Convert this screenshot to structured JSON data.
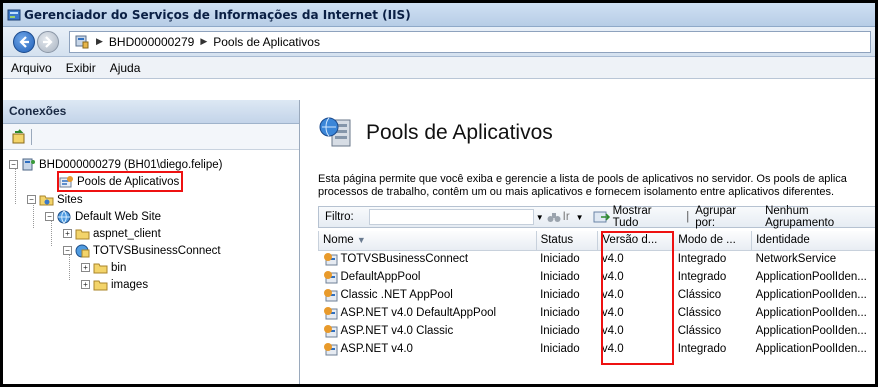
{
  "window": {
    "title": "Gerenciador do Serviços de Informações da Internet (IIS)"
  },
  "address": {
    "segments": [
      "BHD000000279",
      "Pools de Aplicativos"
    ]
  },
  "menu": {
    "items": [
      "Arquivo",
      "Exibir",
      "Ajuda"
    ]
  },
  "connections": {
    "header": "Conexões",
    "tree": {
      "server": "BHD000000279 (BH01\\diego.felipe)",
      "app_pools": "Pools de Aplicativos",
      "sites": "Sites",
      "default_site": "Default Web Site",
      "aspnet_client": "aspnet_client",
      "totvs": "TOTVSBusinessConnect",
      "bin": "bin",
      "images": "images"
    }
  },
  "content": {
    "title": "Pools de Aplicativos",
    "description_line1": "Esta página permite que você exiba e gerencie a lista de pools de aplicativos no servidor. Os pools de aplica",
    "description_line2": "processos de trabalho, contêm um ou mais aplicativos e fornecem isolamento entre aplicativos diferentes.",
    "filter": {
      "label": "Filtro:",
      "go_label": "Ir",
      "show_all_label": "Mostrar Tudo",
      "group_by_label": "Agrupar por:",
      "group_by_value": "Nenhum Agrupamento"
    },
    "columns": [
      "Nome",
      "Status",
      "Versão d...",
      "Modo de ...",
      "Identidade"
    ],
    "rows": [
      {
        "name": "TOTVSBusinessConnect",
        "status": "Iniciado",
        "version": "v4.0",
        "mode": "Integrado",
        "identity": "NetworkService"
      },
      {
        "name": "DefaultAppPool",
        "status": "Iniciado",
        "version": "v4.0",
        "mode": "Integrado",
        "identity": "ApplicationPoolIden..."
      },
      {
        "name": "Classic .NET AppPool",
        "status": "Iniciado",
        "version": "v4.0",
        "mode": "Clássico",
        "identity": "ApplicationPoolIden..."
      },
      {
        "name": "ASP.NET v4.0 DefaultAppPool",
        "status": "Iniciado",
        "version": "v4.0",
        "mode": "Clássico",
        "identity": "ApplicationPoolIden..."
      },
      {
        "name": "ASP.NET v4.0 Classic",
        "status": "Iniciado",
        "version": "v4.0",
        "mode": "Clássico",
        "identity": "ApplicationPoolIden..."
      },
      {
        "name": "ASP.NET v4.0",
        "status": "Iniciado",
        "version": "v4.0",
        "mode": "Integrado",
        "identity": "ApplicationPoolIden..."
      }
    ]
  },
  "colors": {
    "highlight": "#e11111",
    "titlebar": "#b7cde6",
    "accent": "#1f5fb8"
  }
}
